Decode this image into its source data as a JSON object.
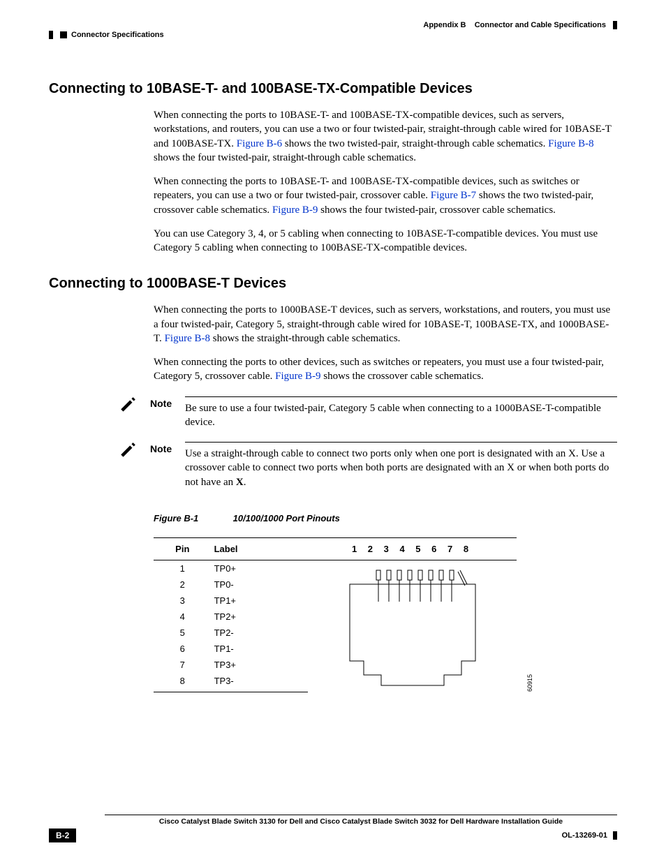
{
  "header": {
    "appendix": "Appendix B",
    "chapter_title": "Connector and Cable Specifications",
    "section_label": "Connector Specifications"
  },
  "sections": {
    "s1_title": "Connecting to 10BASE-T- and 100BASE-TX-Compatible Devices",
    "s1_p1a": "When connecting the ports to 10BASE-T- and 100BASE-TX-compatible devices, such as servers, workstations, and routers, you can use a two or four twisted-pair, straight-through cable wired for 10BASE-T and 100BASE-TX. ",
    "s1_p1_link1": "Figure B-6",
    "s1_p1b": " shows the two twisted-pair, straight-through cable schematics. ",
    "s1_p1_link2": "Figure B-8",
    "s1_p1c": " shows the four twisted-pair, straight-through cable schematics.",
    "s1_p2a": "When connecting the ports to 10BASE-T- and 100BASE-TX-compatible devices, such as switches or repeaters, you can use a two or four twisted-pair, crossover cable. ",
    "s1_p2_link1": "Figure B-7",
    "s1_p2b": " shows the two twisted-pair, crossover cable schematics. ",
    "s1_p2_link2": "Figure B-9",
    "s1_p2c": " shows the four twisted-pair, crossover cable schematics.",
    "s1_p3": "You can use Category 3, 4, or 5 cabling when connecting to 10BASE-T-compatible devices. You must use Category 5 cabling when connecting to 100BASE-TX-compatible devices.",
    "s2_title": "Connecting to 1000BASE-T Devices",
    "s2_p1a": "When connecting the ports to 1000BASE-T devices, such as servers, workstations, and routers, you must use a four twisted-pair, Category 5, straight-through cable wired for 10BASE-T, 100BASE-TX, and 1000BASE-T. ",
    "s2_p1_link1": "Figure B-8",
    "s2_p1b": " shows the straight-through cable schematics.",
    "s2_p2a": "When connecting the ports to other devices, such as switches or repeaters, you must use a four twisted-pair, Category 5, crossover cable. ",
    "s2_p2_link1": "Figure B-9",
    "s2_p2b": " shows the crossover cable schematics."
  },
  "notes": {
    "label": "Note",
    "n1": "Be sure to use a four twisted-pair, Category 5 cable when connecting to a 1000BASE-T-compatible device.",
    "n2a": "Use a straight-through cable to connect two ports only when one port is designated with an X. Use a crossover cable to connect two ports when both ports are designated with an X or when both ports do not have an ",
    "n2b": "X",
    "n2c": "."
  },
  "figure": {
    "num": "Figure B-1",
    "title": "10/100/1000 Port Pinouts",
    "col_pin": "Pin",
    "col_label": "Label",
    "pin_header": "1 2 3 4 5 6 7 8",
    "diagram_id": "60915",
    "rows": [
      {
        "pin": "1",
        "label": "TP0+"
      },
      {
        "pin": "2",
        "label": "TP0-"
      },
      {
        "pin": "3",
        "label": "TP1+"
      },
      {
        "pin": "4",
        "label": "TP2+"
      },
      {
        "pin": "5",
        "label": "TP2-"
      },
      {
        "pin": "6",
        "label": "TP1-"
      },
      {
        "pin": "7",
        "label": "TP3+"
      },
      {
        "pin": "8",
        "label": "TP3-"
      }
    ]
  },
  "footer": {
    "guide_title": "Cisco Catalyst Blade Switch 3130 for Dell and Cisco Catalyst Blade Switch 3032 for Dell Hardware Installation Guide",
    "page_num": "B-2",
    "doc_id": "OL-13269-01"
  }
}
